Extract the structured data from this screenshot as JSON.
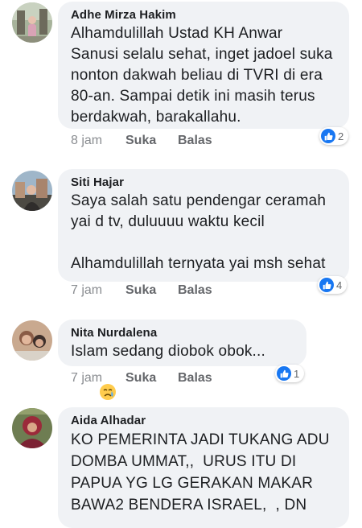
{
  "comments": [
    {
      "author": "Adhe Mirza Hakim",
      "text": "Alhamdulillah Ustad KH Anwar\nSanusi selalu sehat, inget jadoel suka\nnonton dakwah beliau di TVRI di era\n80-an. Sampai detik ini masih terus\nberdakwah, barakallahu.",
      "time": "8 jam",
      "like_label": "Suka",
      "reply_label": "Balas",
      "reaction_icon": "thumbs-up-icon",
      "reaction_count": "2"
    },
    {
      "author": "Siti Hajar",
      "text": "Saya salah satu pendengar ceramah\nyai d tv, duluuuu waktu kecil\n\nAlhamdulillah ternyata yai msh sehat",
      "time": "7 jam",
      "like_label": "Suka",
      "reply_label": "Balas",
      "reaction_icon": "thumbs-up-icon",
      "reaction_count": "4"
    },
    {
      "author": "Nita Nurdalena",
      "text": "Islam sedang diobok obok...",
      "emoji": "crying-face-emoji",
      "time": "7 jam",
      "like_label": "Suka",
      "reply_label": "Balas",
      "reaction_icon": "thumbs-up-icon",
      "reaction_count": "1"
    },
    {
      "author": "Aida Alhadar",
      "text": "KO PEMERINTA JADI TUKANG ADU\nDOMBA UMMAT,,  URUS ITU DI\nPAPUA YG LG GERAKAN MAKAR\nBAWA2 BENDERA ISRAEL,  , DN"
    }
  ],
  "colors": {
    "bubble": "#f0f2f5",
    "accent": "#1877f2",
    "meta": "#65676b"
  }
}
